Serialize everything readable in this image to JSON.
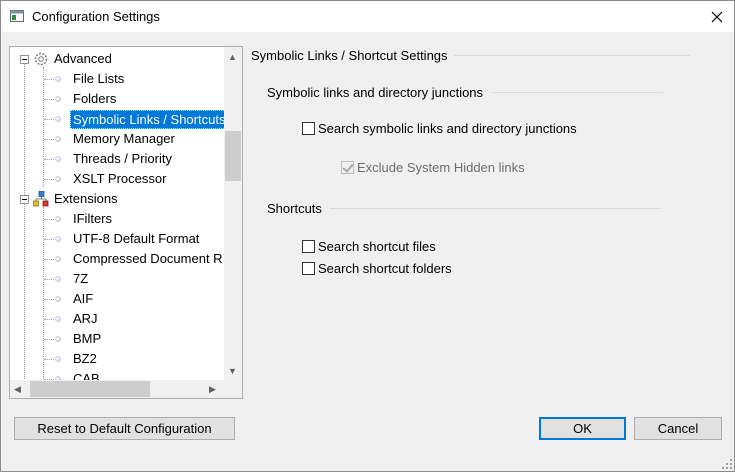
{
  "window": {
    "title": "Configuration Settings",
    "close_glyph": "✕"
  },
  "tree": {
    "items": [
      {
        "label": "Advanced",
        "icon": "gear-icon",
        "level": 0,
        "expanded": true
      },
      {
        "label": "File Lists",
        "level": 1
      },
      {
        "label": "Folders",
        "level": 1
      },
      {
        "label": "Symbolic Links / Shortcuts",
        "level": 1,
        "selected": true
      },
      {
        "label": "Memory Manager",
        "level": 1
      },
      {
        "label": "Threads / Priority",
        "level": 1
      },
      {
        "label": "XSLT Processor",
        "level": 1
      },
      {
        "label": "Extensions",
        "icon": "extensions-icon",
        "level": 0,
        "expanded": true
      },
      {
        "label": "IFilters",
        "level": 1
      },
      {
        "label": "UTF-8 Default Format",
        "level": 1
      },
      {
        "label": "Compressed Document R",
        "level": 1
      },
      {
        "label": "7Z",
        "level": 1
      },
      {
        "label": "AIF",
        "level": 1
      },
      {
        "label": "ARJ",
        "level": 1
      },
      {
        "label": "BMP",
        "level": 1
      },
      {
        "label": "BZ2",
        "level": 1
      },
      {
        "label": "CAB",
        "level": 1
      }
    ],
    "scroll_up": "▲",
    "scroll_down": "▼",
    "scroll_left": "◀",
    "scroll_right": "▶"
  },
  "panel": {
    "heading": "Symbolic Links / Shortcut Settings",
    "groups": [
      {
        "title": "Symbolic links and directory junctions",
        "options": [
          {
            "label": "Search symbolic links and directory junctions",
            "checked": false,
            "enabled": true
          },
          {
            "label": "Exclude System Hidden links",
            "checked": true,
            "enabled": false
          }
        ]
      },
      {
        "title": "Shortcuts",
        "options": [
          {
            "label": "Search shortcut files",
            "checked": false,
            "enabled": true
          },
          {
            "label": "Search shortcut folders",
            "checked": false,
            "enabled": true
          }
        ]
      }
    ]
  },
  "buttons": {
    "reset": "Reset to Default Configuration",
    "ok": "OK",
    "cancel": "Cancel"
  },
  "colors": {
    "selection": "#0078d7",
    "default_button_border": "#0078d7"
  }
}
